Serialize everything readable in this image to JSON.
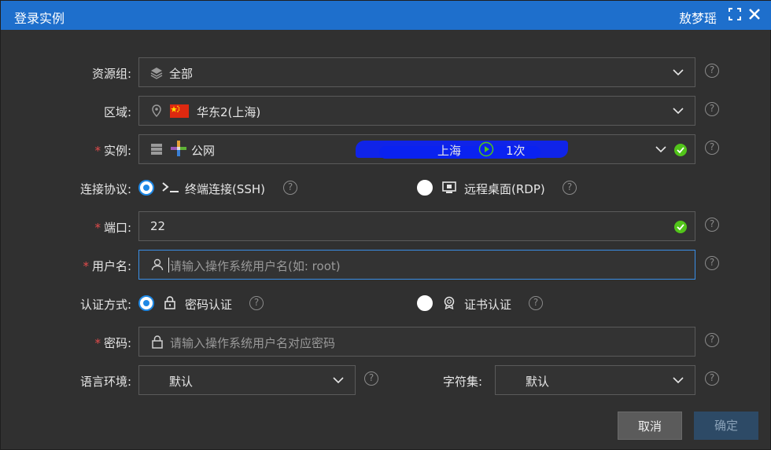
{
  "title": "登录实例",
  "user": "敖梦瑶",
  "form": {
    "resource_group": {
      "label": "资源组:",
      "value": "全部"
    },
    "region": {
      "label": "区域:",
      "value": "华东2(上海)"
    },
    "instance": {
      "required": "*",
      "label": "实例:",
      "network": "公网",
      "location": "上海",
      "times": "1次"
    },
    "protocol": {
      "label": "连接协议:",
      "options": [
        "终端连接(SSH)",
        "远程桌面(RDP)"
      ],
      "selected": "终端连接(SSH)"
    },
    "port": {
      "required": "*",
      "label": "端口:",
      "value": "22"
    },
    "username": {
      "required": "*",
      "label": "用户名:",
      "placeholder": "请输入操作系统用户名(如: root)"
    },
    "auth": {
      "label": "认证方式:",
      "options": [
        "密码认证",
        "证书认证"
      ],
      "selected": "密码认证"
    },
    "password": {
      "required": "*",
      "label": "密码:",
      "placeholder": "请输入操作系统用户名对应密码"
    },
    "language": {
      "label": "语言环境:",
      "value": "默认"
    },
    "charset": {
      "label": "字符集:",
      "value": "默认"
    }
  },
  "buttons": {
    "cancel": "取消",
    "confirm": "确定"
  },
  "colors": {
    "titlebar": "#1e6fcc",
    "accent": "#1e88e5",
    "success": "#52c41a",
    "required": "#e24b4b"
  }
}
